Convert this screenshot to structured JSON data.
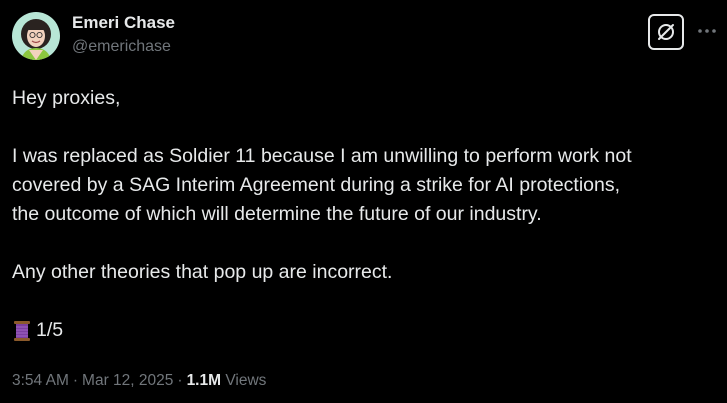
{
  "author": {
    "display_name": "Emeri Chase",
    "handle": "@emerichase"
  },
  "icons": {
    "avatar": "profile-photo",
    "grok": "grok-slash-circle-icon",
    "more": "more-horizontal-icon",
    "thread": "spool-of-thread-emoji"
  },
  "post": {
    "greeting": "Hey proxies,",
    "body_line_1": "I was replaced as Soldier 11 because I am unwilling to perform work not",
    "body_line_2": "covered by a SAG Interim Agreement during a strike for AI protections,",
    "body_line_3": "the outcome of which will determine the future of our industry.",
    "closing": "Any other theories that pop up are incorrect.",
    "thread_counter": "1/5"
  },
  "meta": {
    "time": "3:54 AM",
    "separator": "·",
    "date": "Mar 12, 2025",
    "views_count": "1.1M",
    "views_label": "Views"
  },
  "colors": {
    "background": "#000000",
    "primary_text": "#e7e9ea",
    "secondary_text": "#71767b",
    "thread_spool": "#7b3fa0"
  }
}
